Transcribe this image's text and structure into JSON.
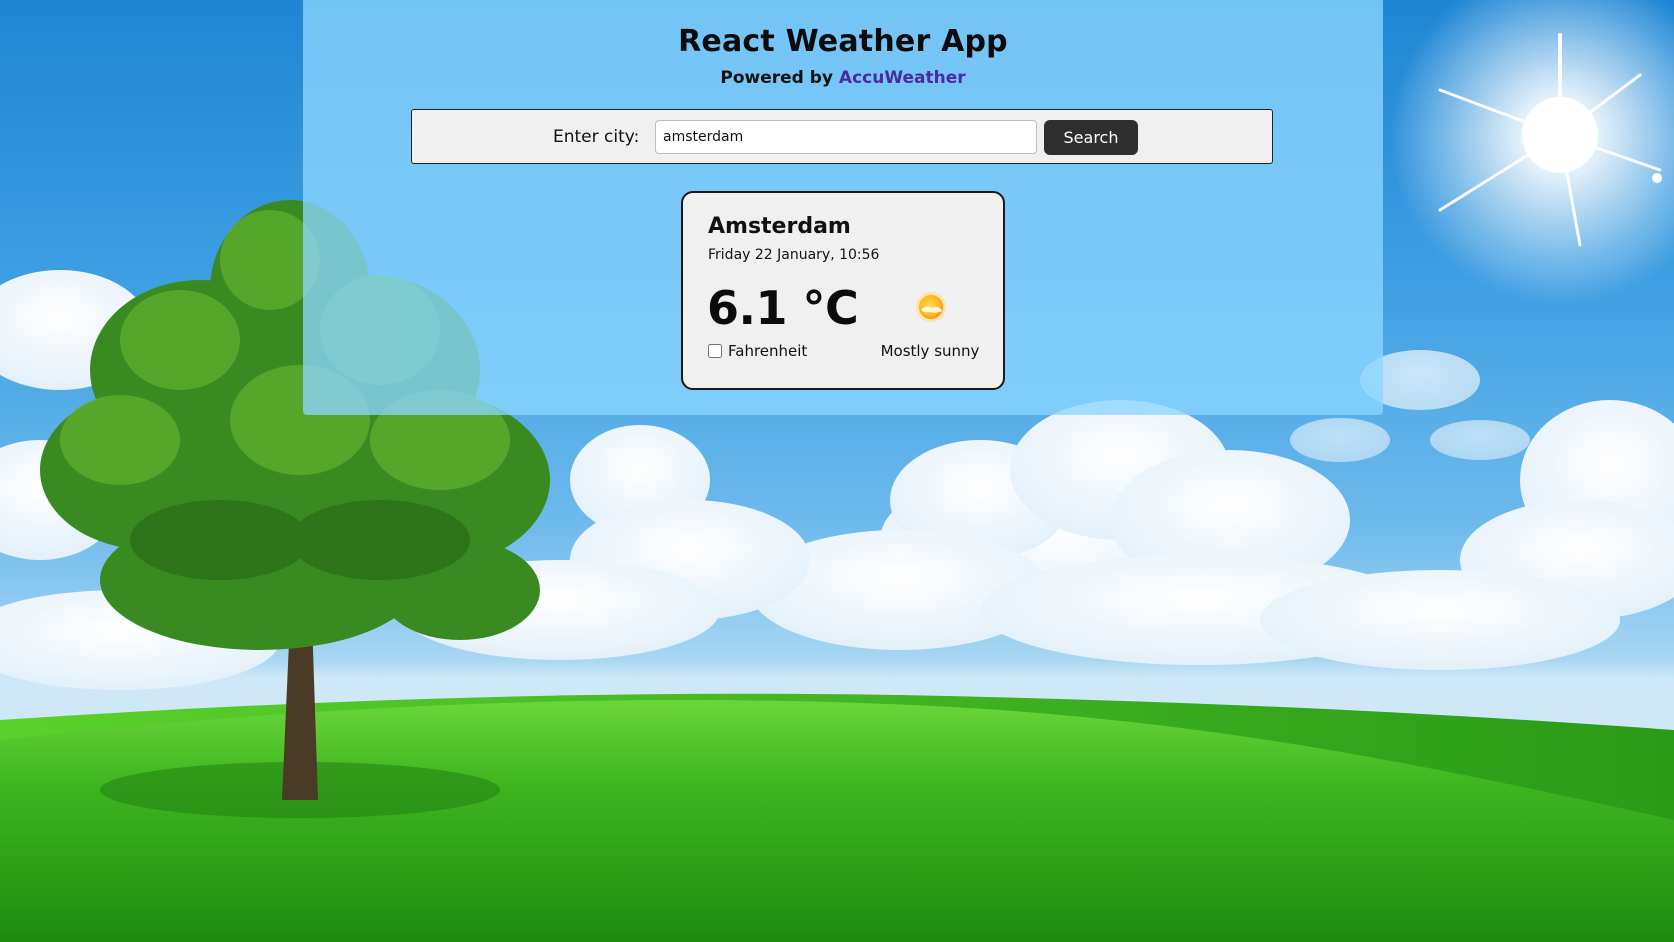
{
  "header": {
    "title": "React Weather App",
    "powered_prefix": "Powered by",
    "powered_link": "AccuWeather"
  },
  "search": {
    "label": "Enter city:",
    "value": "amsterdam",
    "button_label": "Search"
  },
  "weather": {
    "city": "Amsterdam",
    "datetime": "Friday 22 January, 10:56",
    "temperature": "6.1 °C",
    "fahrenheit_label": "Fahrenheit",
    "fahrenheit_checked": false,
    "condition": "Mostly sunny",
    "icon": "mostly-sunny-icon"
  },
  "colors": {
    "link": "#4b2aa3",
    "button": "#2f2f2f",
    "panel": "rgba(140,214,255,0.78)"
  }
}
